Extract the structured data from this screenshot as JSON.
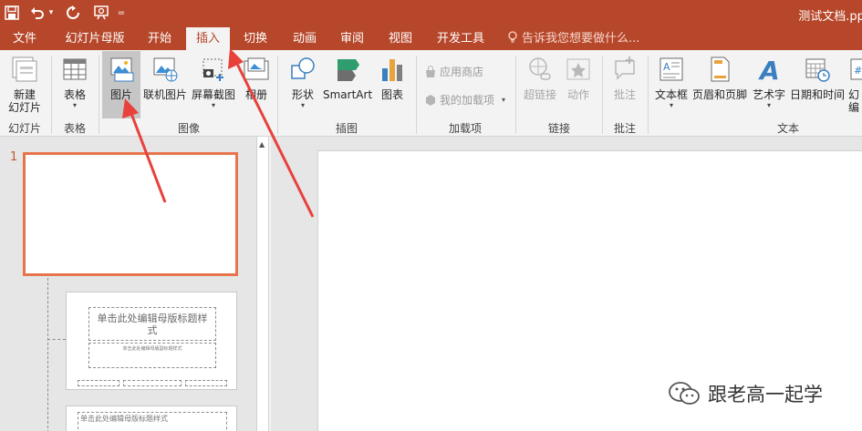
{
  "window": {
    "title": "测试文档.ppt"
  },
  "quick_access": {
    "undo_caret": "▾",
    "more": "="
  },
  "tabs": [
    {
      "label": "文件"
    },
    {
      "label": "幻灯片母版"
    },
    {
      "label": "开始"
    },
    {
      "label": "插入"
    },
    {
      "label": "切换"
    },
    {
      "label": "动画"
    },
    {
      "label": "审阅"
    },
    {
      "label": "视图"
    },
    {
      "label": "开发工具"
    }
  ],
  "tell_me": {
    "text": "告诉我您想要做什么..."
  },
  "ribbon": {
    "new_slide": {
      "line1": "新建",
      "line2": "幻灯片"
    },
    "table": {
      "label": "表格"
    },
    "picture": {
      "label": "图片"
    },
    "online_picture": {
      "label": "联机图片"
    },
    "screenshot": {
      "label": "屏幕截图"
    },
    "album": {
      "label": "相册"
    },
    "shapes": {
      "label": "形状"
    },
    "smartart": {
      "label": "SmartArt"
    },
    "chart": {
      "label": "图表"
    },
    "app_store": {
      "label": "应用商店"
    },
    "my_addins": {
      "label": "我的加载项"
    },
    "hyperlink": {
      "label": "超链接"
    },
    "action": {
      "label": "动作"
    },
    "comment": {
      "label": "批注"
    },
    "textbox": {
      "label": "文本框"
    },
    "header_footer": {
      "label": "页眉和页脚"
    },
    "wordart": {
      "label": "艺术字"
    },
    "datetime": {
      "label": "日期和时间"
    },
    "slide_number": {
      "line1": "幻",
      "line2": "编"
    },
    "groups": {
      "slides": "幻灯片",
      "tables": "表格",
      "images": "图像",
      "illustrations": "插图",
      "addins": "加载项",
      "links": "链接",
      "comments": "批注",
      "text": "文本"
    }
  },
  "thumbnails": {
    "slide_number": "1",
    "master_title": "单击此处编辑母版标题样式",
    "master_subtitle": "单击此处编辑母版副标题样式",
    "layout_title": "单击此处编辑母版标题样式"
  },
  "watermark": {
    "text": "跟老高一起学"
  },
  "colors": {
    "accent": "#b7472a",
    "selection": "#e6744d",
    "arrow": "#e8413b"
  }
}
